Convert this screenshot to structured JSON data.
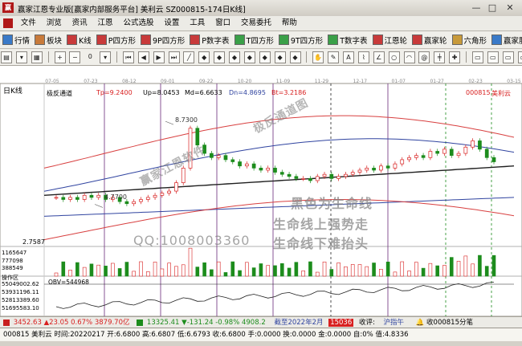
{
  "window": {
    "logo": "赢",
    "title": "赢家江恩专业版[赢家内部服务平台]   美利云   SZ000815-174日K线]",
    "controls": [
      "—",
      "□",
      "✕"
    ]
  },
  "menu": [
    "文件",
    "浏览",
    "资讯",
    "江恩",
    "公式选股",
    "设置",
    "工具",
    "窗口",
    "交易委托",
    "帮助"
  ],
  "toolbar1": [
    {
      "label": "行情",
      "icon": "grid-icon",
      "color": "#3a7ac8"
    },
    {
      "label": "板块",
      "icon": "blocks-icon",
      "color": "#c87a3a"
    },
    {
      "label": "K线",
      "icon": "kline-icon",
      "color": "#c83a3a"
    },
    {
      "label": "P四方形",
      "icon": "square-icon",
      "color": "#c83a3a"
    },
    {
      "label": "9P四方形",
      "icon": "square-icon",
      "color": "#c83a3a"
    },
    {
      "label": "P数字表",
      "icon": "table-icon",
      "color": "#c83a3a"
    },
    {
      "label": "T四方形",
      "icon": "square-icon",
      "color": "#3aa048"
    },
    {
      "label": "9T四方形",
      "icon": "square-icon",
      "color": "#3aa048"
    },
    {
      "label": "T数字表",
      "icon": "table-icon",
      "color": "#3aa048"
    },
    {
      "label": "江恩轮",
      "icon": "wheel-icon",
      "color": "#c83a3a"
    },
    {
      "label": "赢家轮",
      "icon": "wheel-icon",
      "color": "#c83a3a"
    },
    {
      "label": "六角形",
      "icon": "hexagon-icon",
      "color": "#c89a3a"
    },
    {
      "label": "赢家服务",
      "icon": "service-icon",
      "color": "#3a7ac8"
    }
  ],
  "toolbar2_zoom": "0",
  "chart": {
    "period": "日K线",
    "stock_name": "美利云",
    "stock_code": "000815",
    "indicator_name": "极反通道",
    "params": {
      "Tp": "Tp=9.2400",
      "Up": "Up=8.0453",
      "Md": "Md=6.6633",
      "Dn": "Dn=4.8695",
      "Bt": "Bt=3.2186"
    },
    "dates": [
      "07-05",
      "07-23",
      "08-12",
      "09-01",
      "09-22",
      "10-20",
      "11-09",
      "11-29",
      "12-17",
      "01-07",
      "01-27",
      "02-23",
      "03-15"
    ],
    "high_label": "8.7300",
    "low_label": "4.7700",
    "y_axis_bottom": "2.7587",
    "volume_axis": [
      "1165647",
      "777098",
      "388549"
    ],
    "obv_label": "OBV=544968",
    "obv_axis": [
      "55049002.62",
      "53931196.11",
      "52813389.60",
      "51695583.10"
    ],
    "upper_label": "操作区"
  },
  "chart_data": {
    "type": "candlestick",
    "title": "",
    "x": [
      "07-05",
      "07-23",
      "08-12",
      "09-01",
      "09-22",
      "10-20",
      "11-09",
      "11-29",
      "12-17",
      "01-07",
      "01-27",
      "02-23",
      "03-15"
    ],
    "marked_high": 8.73,
    "marked_low": 4.77,
    "channel": {
      "Tp": 9.24,
      "Up": 8.0453,
      "Md": 6.6633,
      "Dn": 4.8695,
      "Bt": 3.2186
    },
    "volume_ticks": [
      1165647,
      777098,
      388549
    ],
    "obv_value": 544968,
    "obv_ticks": [
      55049002.62,
      53931196.11,
      52813389.6,
      51695583.1
    ],
    "close": [
      5.1,
      5.0,
      5.1,
      5.0,
      5.2,
      5.1,
      5.2,
      5.0,
      5.1,
      4.9,
      4.8,
      4.9,
      5.0,
      5.1,
      5.2,
      5.3,
      5.4,
      5.8,
      6.5,
      8.4,
      7.6,
      7.2,
      7.0,
      7.1,
      6.9,
      6.8,
      6.6,
      6.7,
      6.5,
      6.4,
      6.5,
      6.3,
      6.2,
      6.1,
      6.0,
      6.0,
      5.9,
      6.1,
      6.2,
      6.0,
      6.1,
      6.2,
      6.3,
      6.4,
      6.5,
      6.4,
      6.6,
      6.5,
      6.7,
      6.9,
      7.0,
      7.1,
      7.0,
      7.3,
      7.2,
      7.4,
      7.1,
      7.2,
      7.5,
      7.8,
      7.4,
      7.0,
      6.8
    ]
  },
  "watermarks": {
    "w1": "赢家江恩软件",
    "w2": "极反通道图",
    "w3": "黑色为生命线",
    "w4": "生命线上强势走",
    "w5": "生命线下难抬头",
    "w6": "QQ:1008003360"
  },
  "status": {
    "index1": "3452.63",
    "index1_change": "▲23.05 0.67% 3879.70亿",
    "index2": "13325.41",
    "index2_change": "▼-131.24 -0.98% 4908.2",
    "deadline": "截至2022年2月",
    "badge": "15036",
    "receive": "收评:",
    "market": "沪指午",
    "right": "收000815分笔"
  },
  "info": {
    "code": "000815 美利云",
    "time": "时间:20220217",
    "open": "开:6.6800",
    "high": "高:6.6807",
    "low": "低:6.6793",
    "close": "收:6.6800",
    "hand": "手:0.0000",
    "change": "换:0.0000",
    "amount": "金:0.0000",
    "yield": "自:0%",
    "value": "值:4.8336"
  },
  "colors": {
    "red": "#d82020",
    "green": "#1c8c1c",
    "channel_red": "#d84040",
    "channel_blue": "#3044a0",
    "lifeline": "#202020",
    "watermark": "#7c7c7c"
  }
}
